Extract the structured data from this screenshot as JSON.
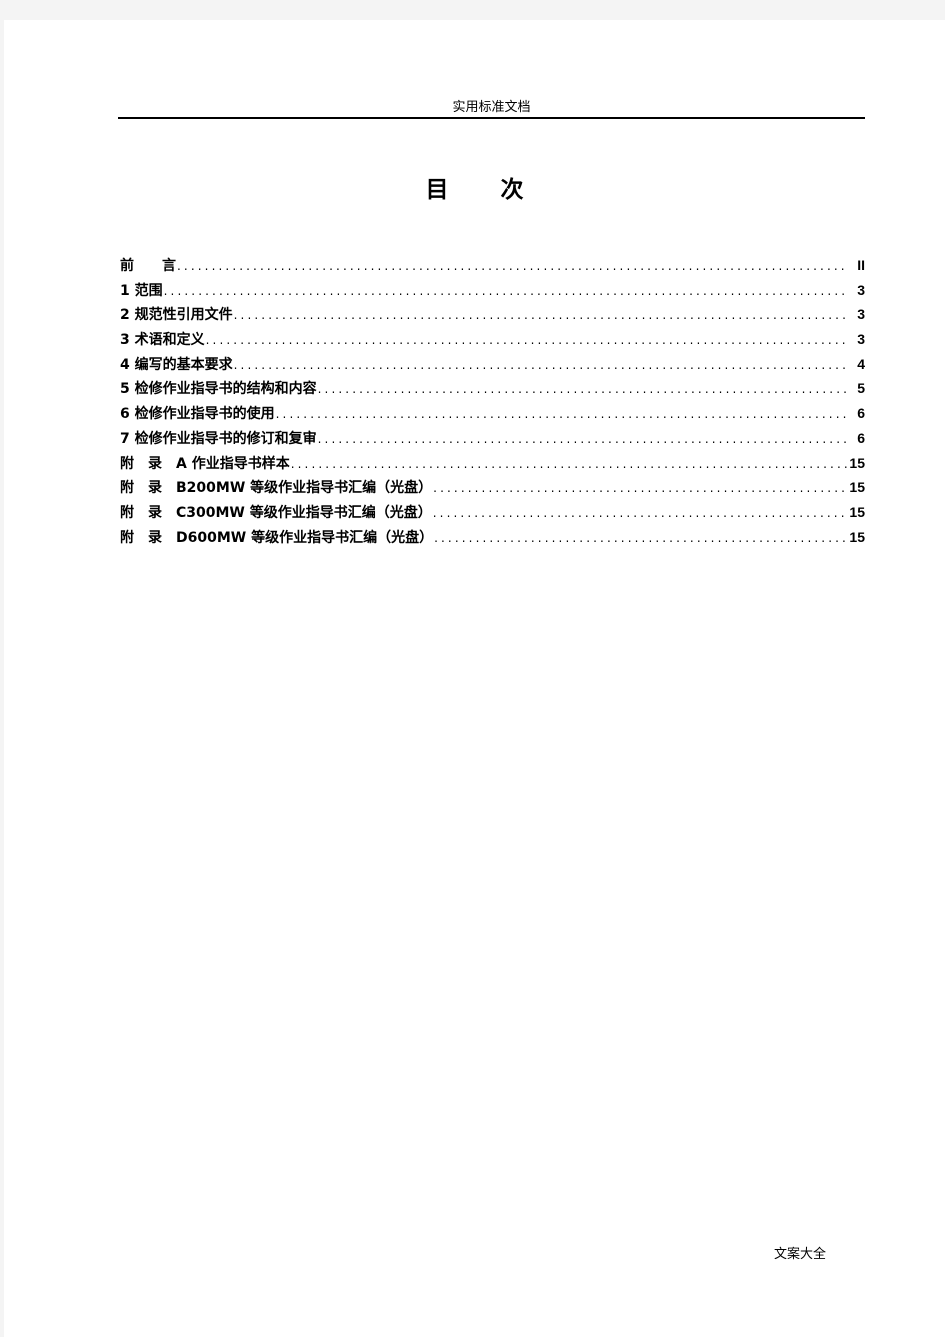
{
  "header": {
    "text": "实用标准文档"
  },
  "title": {
    "chars": [
      "目",
      "次"
    ]
  },
  "toc": [
    {
      "label": "前　　言",
      "page": "II"
    },
    {
      "label": "1 范围",
      "page": "3"
    },
    {
      "label": "2 规范性引用文件",
      "page": "3"
    },
    {
      "label": "3 术语和定义",
      "page": "3"
    },
    {
      "label": "4 编写的基本要求",
      "page": "4"
    },
    {
      "label": "5 检修作业指导书的结构和内容",
      "page": "5"
    },
    {
      "label": "6 检修作业指导书的使用",
      "page": "6"
    },
    {
      "label": "7 检修作业指导书的修订和复审",
      "page": "6"
    },
    {
      "label": "附　录　A 作业指导书样本",
      "page": "15"
    },
    {
      "label": "附　录　B200MW 等级作业指导书汇编（光盘）",
      "page": "15"
    },
    {
      "label": "附　录　C300MW 等级作业指导书汇编（光盘）",
      "page": "15"
    },
    {
      "label": "附　录　D600MW 等级作业指导书汇编（光盘）",
      "page": "15"
    }
  ],
  "footer": {
    "text": "文案大全"
  }
}
